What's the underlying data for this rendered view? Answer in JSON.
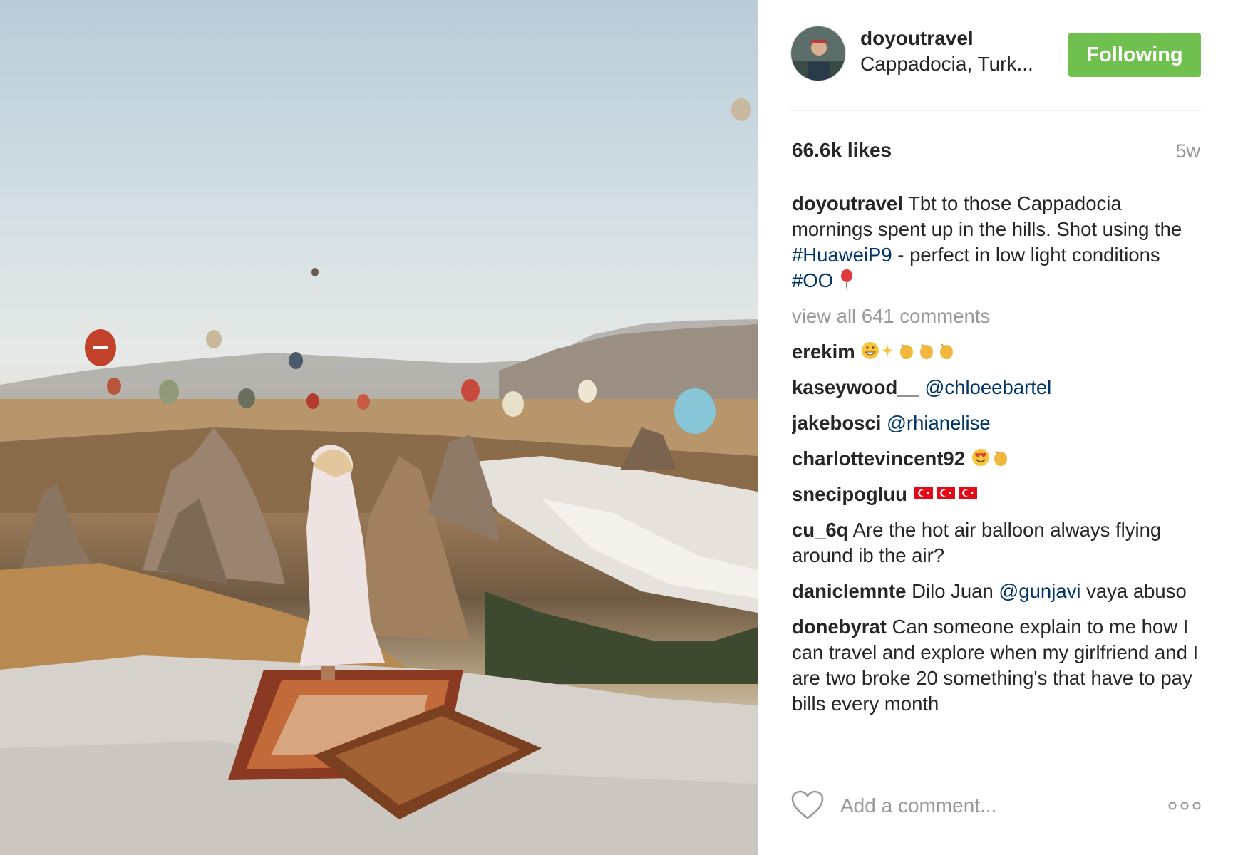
{
  "post": {
    "username": "doyoutravel",
    "location": "Cappadocia, Turk...",
    "follow_label": "Following",
    "likes": "66.6k likes",
    "age": "5w",
    "caption": {
      "user": "doyoutravel",
      "text_1": "Tbt to those Cappadocia mornings spent up in the hills. Shot using the",
      "tag_1": "#HuaweiP9",
      "text_2": "- perfect in low light conditions",
      "tag_2": "#OO"
    },
    "view_all": "view all 641 comments",
    "comments": [
      {
        "user": "erekim",
        "text": ""
      },
      {
        "user": "kaseywood__",
        "mention": "@chloeebartel"
      },
      {
        "user": "jakebosci",
        "mention": "@rhianelise"
      },
      {
        "user": "charlottevincent92",
        "text": ""
      },
      {
        "user": "snecipogluu",
        "text": ""
      },
      {
        "user": "cu_6q",
        "text": "Are the hot air balloon always flying around ib the air?"
      },
      {
        "user": "daniclemnte",
        "text": "Dilo Juan",
        "mention": "@gunjavi",
        "text_after": "vaya abuso"
      },
      {
        "user": "donebyrat",
        "text": "Can someone explain to me how I can travel and explore when my girlfriend and I are two broke 20 something's that have to pay bills every month"
      }
    ],
    "add_comment_placeholder": "Add a comment..."
  },
  "colors": {
    "follow_green": "#70c050",
    "hashtag_blue": "#003569",
    "muted_gray": "#999999"
  },
  "icons": {
    "like": "heart-outline-icon",
    "more": "more-options-icon"
  }
}
